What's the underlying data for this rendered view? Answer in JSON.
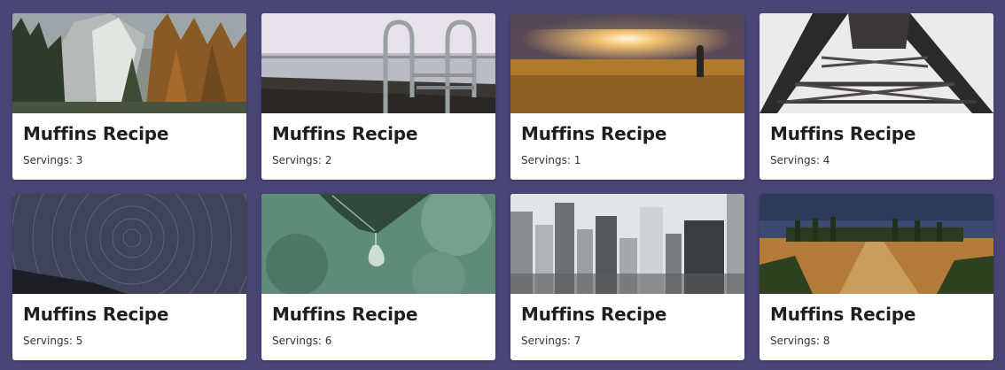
{
  "cards": [
    {
      "title": "Muffins Recipe",
      "servings": "Servings: 3",
      "image": "forest-mountain-image"
    },
    {
      "title": "Muffins Recipe",
      "servings": "Servings: 2",
      "image": "pool-ladder-lake-image"
    },
    {
      "title": "Muffins Recipe",
      "servings": "Servings: 1",
      "image": "sunset-field-image"
    },
    {
      "title": "Muffins Recipe",
      "servings": "Servings: 4",
      "image": "steel-tower-image"
    },
    {
      "title": "Muffins Recipe",
      "servings": "Servings: 5",
      "image": "star-trails-image"
    },
    {
      "title": "Muffins Recipe",
      "servings": "Servings: 6",
      "image": "leaf-waterdrop-image"
    },
    {
      "title": "Muffins Recipe",
      "servings": "Servings: 7",
      "image": "city-skyline-image"
    },
    {
      "title": "Muffins Recipe",
      "servings": "Servings: 8",
      "image": "countryside-path-image"
    }
  ],
  "colors": {
    "background": "#4a4577",
    "card": "#ffffff",
    "title": "#1f1f1f",
    "servings": "#333333"
  }
}
